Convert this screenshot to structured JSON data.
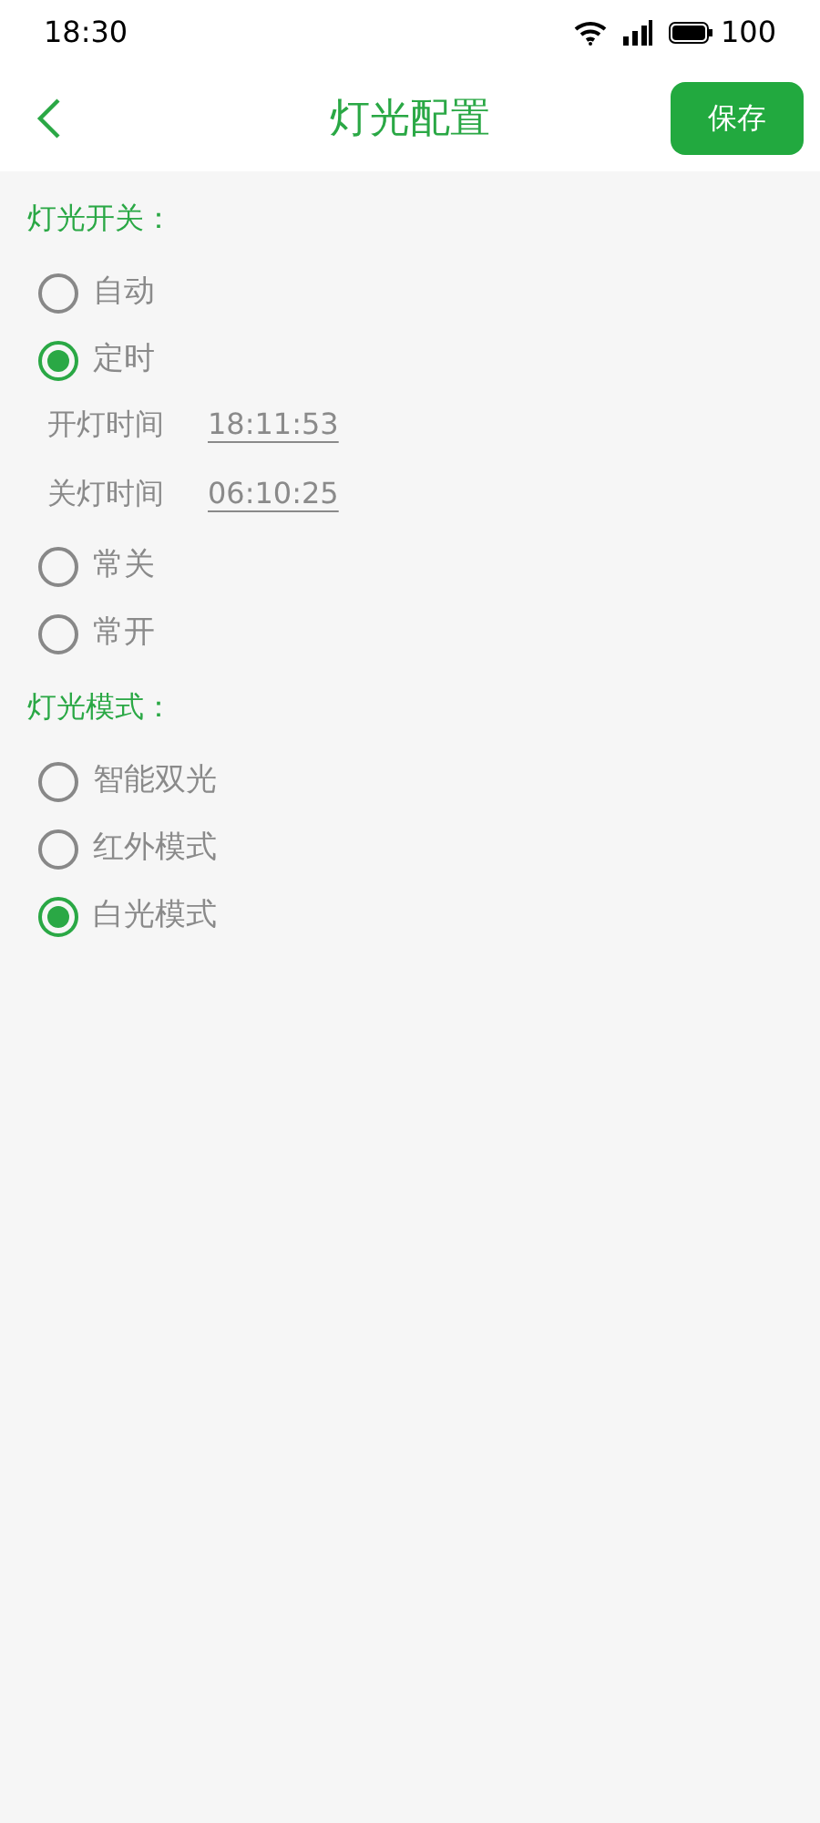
{
  "status_bar": {
    "time": "18:30",
    "battery": "100"
  },
  "header": {
    "title": "灯光配置",
    "save": "保存"
  },
  "sections": [
    {
      "title": "灯光开关：",
      "options": [
        {
          "label": "自动",
          "selected": false
        },
        {
          "label": "定时",
          "selected": true,
          "times": [
            {
              "label": "开灯时间",
              "value": "18:11:53"
            },
            {
              "label": "关灯时间",
              "value": "06:10:25"
            }
          ]
        },
        {
          "label": "常关",
          "selected": false
        },
        {
          "label": "常开",
          "selected": false
        }
      ]
    },
    {
      "title": "灯光模式：",
      "options": [
        {
          "label": "智能双光",
          "selected": false
        },
        {
          "label": "红外模式",
          "selected": false
        },
        {
          "label": "白光模式",
          "selected": true
        }
      ]
    }
  ]
}
